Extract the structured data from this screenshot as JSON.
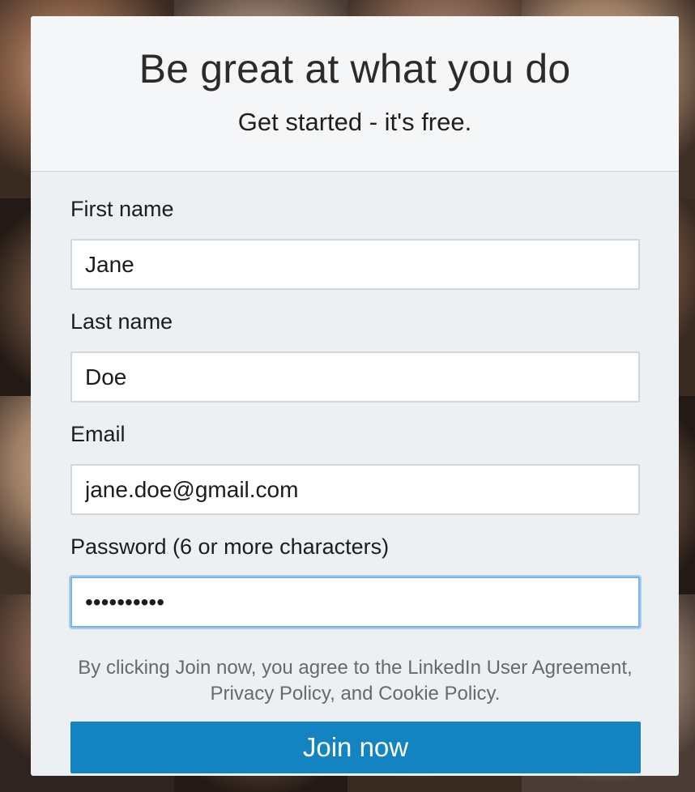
{
  "header": {
    "title": "Be great at what you do",
    "subtitle": "Get started - it's free."
  },
  "form": {
    "first_name": {
      "label": "First name",
      "value": "Jane"
    },
    "last_name": {
      "label": "Last name",
      "value": "Doe"
    },
    "email": {
      "label": "Email",
      "value": "jane.doe@gmail.com"
    },
    "password": {
      "label": "Password (6 or more characters)",
      "value": "••••••••••"
    },
    "legal_text": "By clicking Join now, you agree to the LinkedIn User Agreement, Privacy Policy, and Cookie Policy.",
    "submit_label": "Join now"
  },
  "colors": {
    "primary_button": "#1383c2",
    "focus_ring": "#7ab3ea",
    "card_background": "#edf0f3"
  }
}
